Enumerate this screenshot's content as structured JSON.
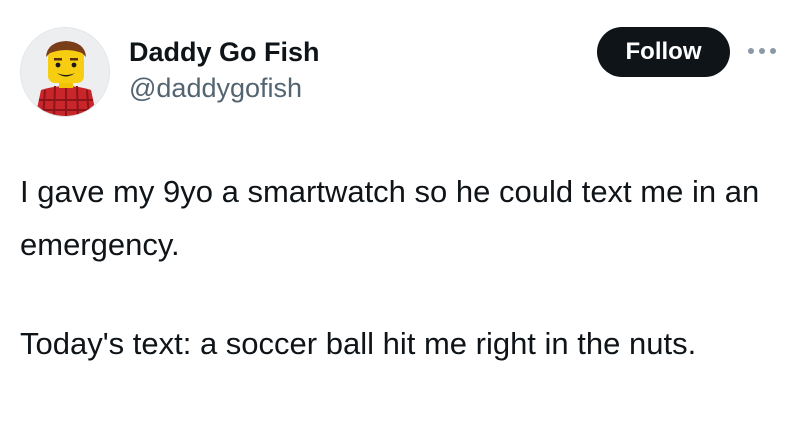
{
  "author": {
    "display_name": "Daddy Go Fish",
    "handle": "@daddygofish",
    "avatar_icon": "lego-minifigure-avatar"
  },
  "actions": {
    "follow_label": "Follow",
    "more_icon": "more-horizontal-icon"
  },
  "tweet": {
    "paragraphs": [
      "I gave my 9yo a smartwatch so he could text me in an emergency.",
      "Today's text: a soccer ball hit me right in the nuts."
    ]
  },
  "colors": {
    "text": "#0f1419",
    "secondary_text": "#536471",
    "follow_button_bg": "#0f1419",
    "follow_button_text": "#ffffff"
  }
}
